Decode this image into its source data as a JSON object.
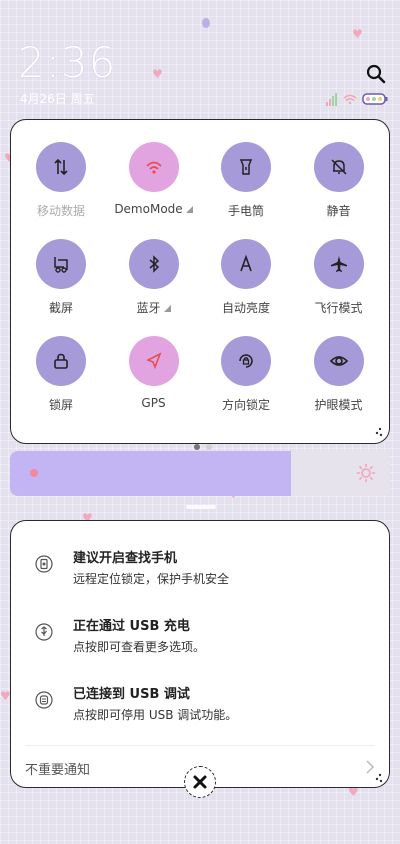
{
  "header": {
    "time": "2:36",
    "date": "4月26日 周五"
  },
  "tiles": [
    {
      "label": "移动数据",
      "icon": "mobile-data-icon",
      "state": "off",
      "dim": true
    },
    {
      "label": "DemoMode",
      "icon": "wifi-icon",
      "state": "on",
      "has_arrow": true
    },
    {
      "label": "手电筒",
      "icon": "flashlight-icon",
      "state": "off"
    },
    {
      "label": "静音",
      "icon": "bell-muted-icon",
      "state": "off"
    },
    {
      "label": "截屏",
      "icon": "screenshot-icon",
      "state": "off"
    },
    {
      "label": "蓝牙",
      "icon": "bluetooth-icon",
      "state": "off",
      "has_arrow": true
    },
    {
      "label": "自动亮度",
      "icon": "auto-brightness-icon",
      "state": "off"
    },
    {
      "label": "飞行模式",
      "icon": "airplane-icon",
      "state": "off"
    },
    {
      "label": "锁屏",
      "icon": "lock-icon",
      "state": "off"
    },
    {
      "label": "GPS",
      "icon": "location-arrow-icon",
      "state": "on"
    },
    {
      "label": "方向锁定",
      "icon": "rotation-lock-icon",
      "state": "off"
    },
    {
      "label": "护眼模式",
      "icon": "eye-icon",
      "state": "off"
    }
  ],
  "brightness": {
    "level": 0.74
  },
  "notifications": [
    {
      "title": "建议开启查找手机",
      "body": "远程定位锁定，保护手机安全",
      "icon": "find-phone-icon"
    },
    {
      "title": "正在通过 USB 充电",
      "body": "点按即可查看更多选项。",
      "icon": "usb-charging-icon"
    },
    {
      "title": "已连接到 USB 调试",
      "body": "点按即可停用 USB 调试功能。",
      "icon": "usb-debug-icon"
    }
  ],
  "footer": {
    "unimportant_label": "不重要通知"
  },
  "colors": {
    "tile_off": "#a79ad8",
    "tile_on": "#e2a4e0",
    "brightness_fill": "#c3b5f3"
  }
}
